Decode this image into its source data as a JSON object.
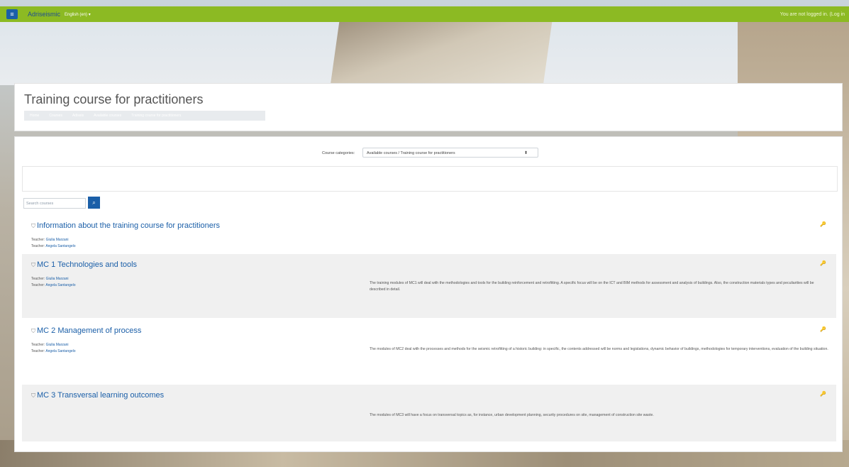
{
  "navbar": {
    "brand": "Adriseismic",
    "language": "English (en) ▾",
    "login_text": "You are not logged in. (Log in"
  },
  "header": {
    "title": "Training course for practitioners",
    "breadcrumb": [
      "Home",
      "Courses",
      "Adiseis",
      "Available courses",
      "Training course for practitioners"
    ]
  },
  "categories": {
    "label": "Course categories:",
    "selected": "Available courses / Training course for practitioners"
  },
  "search": {
    "placeholder": "Search courses"
  },
  "courses": [
    {
      "title": "Information about the training course for practitioners",
      "teachers": [
        {
          "role": "Teacher:",
          "name": "Giulia Marzani"
        },
        {
          "role": "Teacher:",
          "name": "Angela Santangelo"
        }
      ],
      "summary": ""
    },
    {
      "title": "MC 1 Technologies and tools",
      "teachers": [
        {
          "role": "Teacher:",
          "name": "Giulia Marzani"
        },
        {
          "role": "Teacher:",
          "name": "Angela Santangelo"
        }
      ],
      "summary": "The training modules of MC1 will deal with the methodologies and tools for the building reinforcement and retrofitting. A specific focus will be on the ICT and BIM methods for assessment and analysis of buildings. Also, the construction materials types and peculiarities will be described in detail."
    },
    {
      "title": "MC 2 Management of process",
      "teachers": [
        {
          "role": "Teacher:",
          "name": "Giulia Marzani"
        },
        {
          "role": "Teacher:",
          "name": "Angela Santangelo"
        }
      ],
      "summary": "The modules of MC2 deal with the processes and methods for the seismic retrofitting of a historic building: in specific, the contents addressed will be norms and legislations, dynamic behavior of buildings, methodologies for temporary interventions, evaluation of the building situation."
    },
    {
      "title": "MC 3 Transversal learning outcomes",
      "teachers": [],
      "summary": "The modules of MC3 will have a focus on transversal topics as, for instance, urban development planning, security procedures on site, management of construction site waste."
    }
  ],
  "colors": {
    "navbar": "#8cba23",
    "primary": "#1b5fa8"
  }
}
